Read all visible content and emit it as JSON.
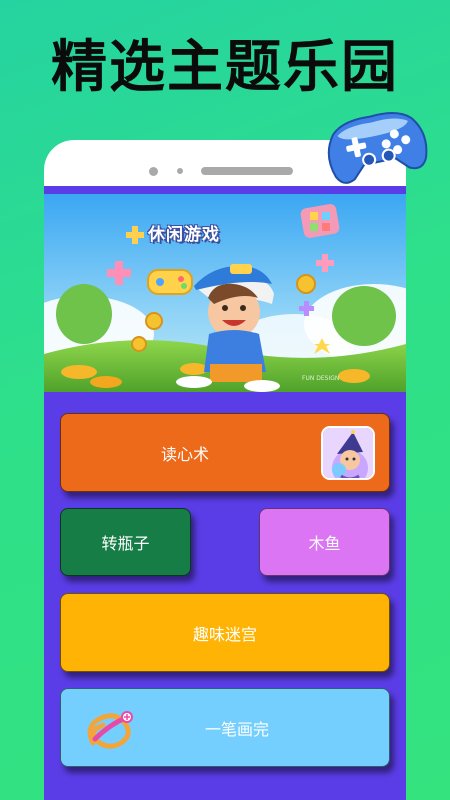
{
  "headline": "精选主题乐园",
  "banner": {
    "title": "休闲游戏",
    "watermark": "FUN DESIGN"
  },
  "games": {
    "read_mind": "读心术",
    "spin_bottle": "转瓶子",
    "wooden_fish": "木鱼",
    "fun_maze": "趣味迷宫",
    "one_stroke": "一笔画完"
  },
  "colors": {
    "background": "#2fe08a",
    "screen": "#5a3de6",
    "read_mind": "#ee6a1b",
    "spin_bottle": "#167d46",
    "wooden_fish": "#dc75f3",
    "fun_maze": "#ffb405",
    "one_stroke": "#74cfff"
  },
  "icons": {
    "controller": "gamepad-icon",
    "read_mind_thumb": "wizard-icon",
    "one_stroke_thumb": "stroke-loop-icon"
  }
}
